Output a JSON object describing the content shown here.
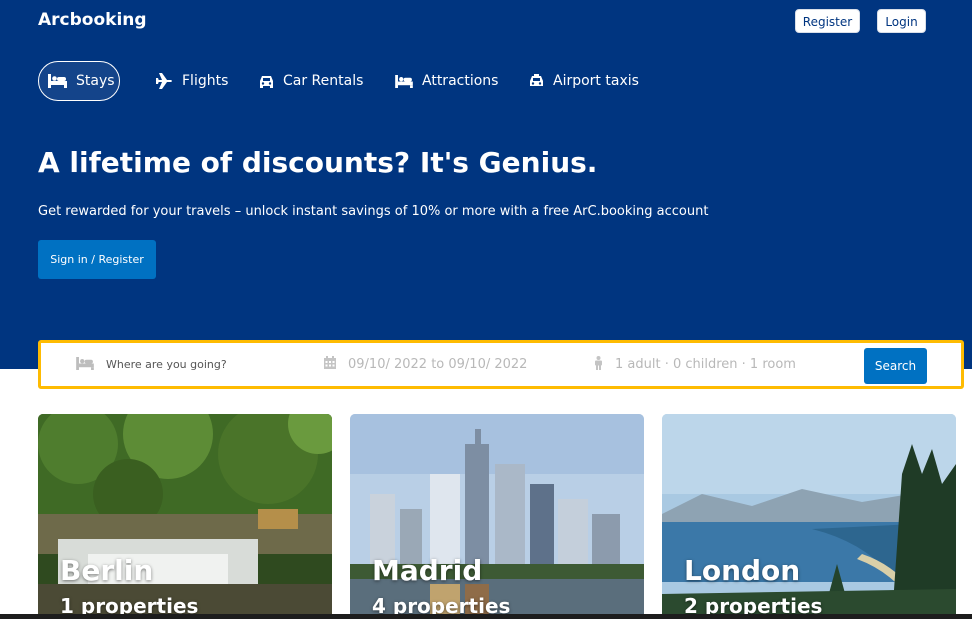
{
  "header": {
    "brand": "Arcbooking",
    "register_label": "Register",
    "login_label": "Login"
  },
  "nav": {
    "items": [
      {
        "label": "Stays",
        "icon": "bed-icon",
        "active": true
      },
      {
        "label": "Flights",
        "icon": "plane-icon",
        "active": false
      },
      {
        "label": "Car Rentals",
        "icon": "car-icon",
        "active": false
      },
      {
        "label": "Attractions",
        "icon": "bed-icon",
        "active": false
      },
      {
        "label": "Airport taxis",
        "icon": "taxi-icon",
        "active": false
      }
    ]
  },
  "hero": {
    "headline": "A lifetime of discounts? It's Genius.",
    "subtext": "Get rewarded for your travels – unlock instant savings of 10% or more with a free ArC.booking account",
    "signin_label": "Sign in / Register"
  },
  "search": {
    "destination_placeholder": "Where are you going?",
    "dates": "09/10/ 2022 to 09/10/ 2022",
    "guests": "1 adult · 0 children · 1 room",
    "search_label": "Search"
  },
  "cards": [
    {
      "city": "Berlin",
      "properties": "1 properties"
    },
    {
      "city": "Madrid",
      "properties": "4 properties"
    },
    {
      "city": "London",
      "properties": "2 properties"
    }
  ],
  "colors": {
    "brand_blue": "#003580",
    "button_blue": "#0071c2",
    "search_border": "#febb02"
  }
}
